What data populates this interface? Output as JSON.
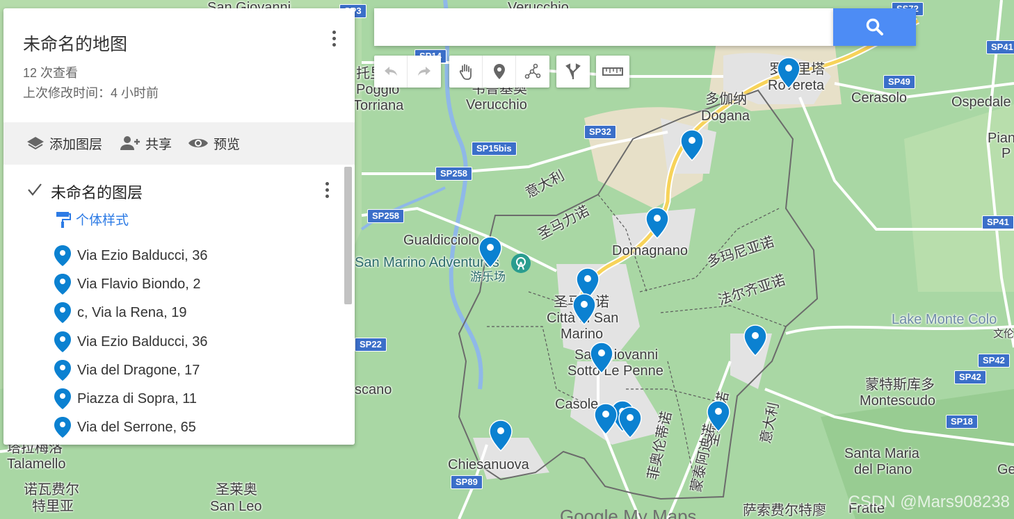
{
  "panel": {
    "title": "未命名的地图",
    "views": "12 次查看",
    "modified": "上次修改时间：4 小时前",
    "actions": {
      "add_layer": "添加图层",
      "share": "共享",
      "preview": "预览"
    },
    "layer": {
      "name": "未命名的图层",
      "checked": true,
      "style_link": "个体样式",
      "items": [
        {
          "label": "Via Ezio Balducci, 36"
        },
        {
          "label": "Via Flavio Biondo, 2"
        },
        {
          "label": "c, Via la Rena, 19"
        },
        {
          "label": "Via Ezio Balducci, 36"
        },
        {
          "label": "Via del Dragone, 17"
        },
        {
          "label": "Piazza di Sopra, 11"
        },
        {
          "label": "Via del Serrone, 65"
        }
      ]
    }
  },
  "search": {
    "value": "",
    "placeholder": ""
  },
  "toolbar": {
    "tools": [
      "undo-icon",
      "redo-icon",
      "hand-icon",
      "marker-icon",
      "draw-line-icon",
      "directions-icon",
      "ruler-icon"
    ]
  },
  "map": {
    "places": [
      {
        "name": "San Giovanni"
      },
      {
        "name": "Verucchio"
      },
      {
        "name": "托里"
      },
      {
        "name": "Poggio"
      },
      {
        "name": "Torriana"
      },
      {
        "name": "韦鲁基奥"
      },
      {
        "name": "Verucchio"
      },
      {
        "name": "罗韦里塔"
      },
      {
        "name": "Rovereta"
      },
      {
        "name": "Cerasolo"
      },
      {
        "name": "Ospedale"
      },
      {
        "name": "多伽纳"
      },
      {
        "name": "Dogana"
      },
      {
        "name": "意大利"
      },
      {
        "name": "圣马力诺"
      },
      {
        "name": "Gualdicciolo"
      },
      {
        "name": "San Marino Adventures"
      },
      {
        "name": "游乐场"
      },
      {
        "name": "Domagnano"
      },
      {
        "name": "多玛尼亚诺"
      },
      {
        "name": "法尔齐亚诺"
      },
      {
        "name": "圣马力诺"
      },
      {
        "name": "Città di San"
      },
      {
        "name": "Marino"
      },
      {
        "name": "San Giovanni"
      },
      {
        "name": "Sotto Le Penne"
      },
      {
        "name": "Lake Monte Colo"
      },
      {
        "name": "文伦"
      },
      {
        "name": "蒙特斯库多"
      },
      {
        "name": "Montescudo"
      },
      {
        "name": "Casole"
      },
      {
        "name": "菲奥伦蒂诺"
      },
      {
        "name": "蒙泰阿迪诺"
      },
      {
        "name": "圣马力诺"
      },
      {
        "name": "意大利"
      },
      {
        "name": "Chiesanuova"
      },
      {
        "name": "scano"
      },
      {
        "name": "塔拉梅洛"
      },
      {
        "name": "Talamello"
      },
      {
        "name": "诺瓦费尔"
      },
      {
        "name": "特里亚"
      },
      {
        "name": "圣莱奥"
      },
      {
        "name": "San Leo"
      },
      {
        "name": "Santa Maria"
      },
      {
        "name": "del Piano"
      },
      {
        "name": "Ge"
      },
      {
        "name": "萨索费尔特廖"
      },
      {
        "name": "Fratte"
      },
      {
        "name": "Pian"
      },
      {
        "name": "P"
      }
    ],
    "road_labels": [
      "SS72",
      "SP41",
      "SP14",
      "SP49",
      "SP32",
      "SP15bis",
      "SP258",
      "SP258",
      "SP41",
      "SP22",
      "SP42",
      "SP42",
      "SP18",
      "SP89",
      "SP3"
    ],
    "attribution": "Google My Maps",
    "watermark": "CSDN @Mars908238"
  },
  "colors": {
    "land": "#a7d7a2",
    "urban": "#e6e6e6",
    "river": "#8fb8e8",
    "highway": "#f7d35a",
    "pin": "#0b81d1",
    "search_button": "#4d8cf5",
    "link": "#2d7be5"
  }
}
